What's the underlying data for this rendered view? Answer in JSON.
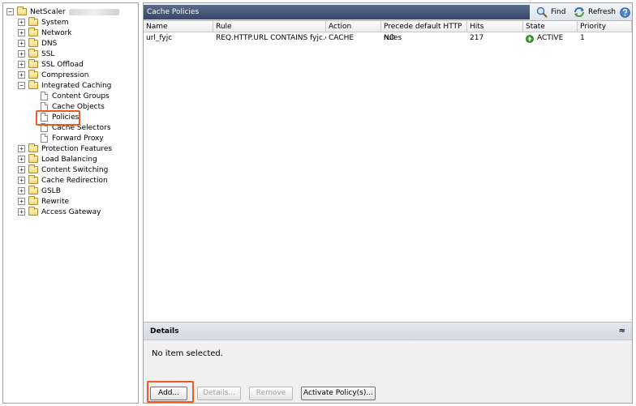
{
  "tree": {
    "root": "NetScaler",
    "items": [
      "System",
      "Network",
      "DNS",
      "SSL",
      "SSL Offload",
      "Compression",
      "Integrated Caching",
      "Protection Features",
      "Load Balancing",
      "Content Switching",
      "Cache Redirection",
      "GSLB",
      "Rewrite",
      "Access Gateway"
    ],
    "children": [
      "Content Groups",
      "Cache Objects",
      "Policies",
      "Cache Selectors",
      "Forward Proxy"
    ],
    "expand_plus": "+",
    "expand_minus": "−"
  },
  "pane": {
    "title": "Cache Policies",
    "find": "Find",
    "refresh": "Refresh"
  },
  "table": {
    "columns": [
      "Name",
      "Rule",
      "Action",
      "Precede default HTTP rules",
      "Hits",
      "State",
      "Priority"
    ],
    "rows": [
      [
        "url_fyjc",
        "REQ.HTTP.URL CONTAINS fyjc.or...",
        "CACHE",
        "NO",
        "217",
        "ACTIVE",
        "1"
      ]
    ]
  },
  "details": {
    "title": "Details",
    "toggle": "≈",
    "message": "No item selected."
  },
  "buttons": {
    "add": "Add...",
    "details": "Details...",
    "remove": "Remove",
    "activate": "Activate Policy(s)..."
  },
  "colors": {
    "highlight": "#f05a22",
    "title_bar": "#38476a",
    "active_green": "#2e9b2e"
  },
  "icons": {
    "find": "magnifier-icon",
    "refresh": "refresh-icon",
    "help": "help-icon",
    "active": "active-state-icon"
  }
}
